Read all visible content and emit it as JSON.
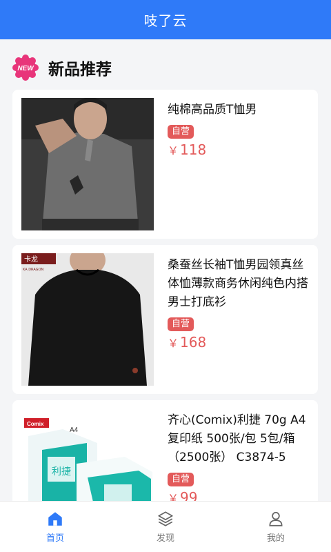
{
  "header": {
    "title": "吱了云"
  },
  "section": {
    "badge": "NEW",
    "title": "新品推荐"
  },
  "products": [
    {
      "title": "纯棉高品质T恤男",
      "tag": "自营",
      "currency": "￥",
      "price": "118"
    },
    {
      "title": "桑蚕丝长袖T恤男园领真丝体恤薄款商务休闲纯色内搭男士打底衫",
      "tag": "自营",
      "currency": "￥",
      "price": "168",
      "brand_mark": "卡龙",
      "brand_sub": "KA DRAGON"
    },
    {
      "title": "齐心(Comix)利捷 70g A4 复印纸 500张/包 5包/箱（2500张） C3874-5",
      "tag": "自营",
      "currency": "￥",
      "price": "99",
      "brand_mark": "Comix",
      "box_text": "利捷",
      "size_text": "A4"
    }
  ],
  "tabbar": {
    "items": [
      {
        "label": "首页",
        "icon": "home-icon",
        "active": true
      },
      {
        "label": "发现",
        "icon": "layers-icon",
        "active": false
      },
      {
        "label": "我的",
        "icon": "user-icon",
        "active": false
      }
    ]
  },
  "colors": {
    "primary": "#2f7af8",
    "accent": "#e35a5a",
    "badge": "#e8357a"
  }
}
